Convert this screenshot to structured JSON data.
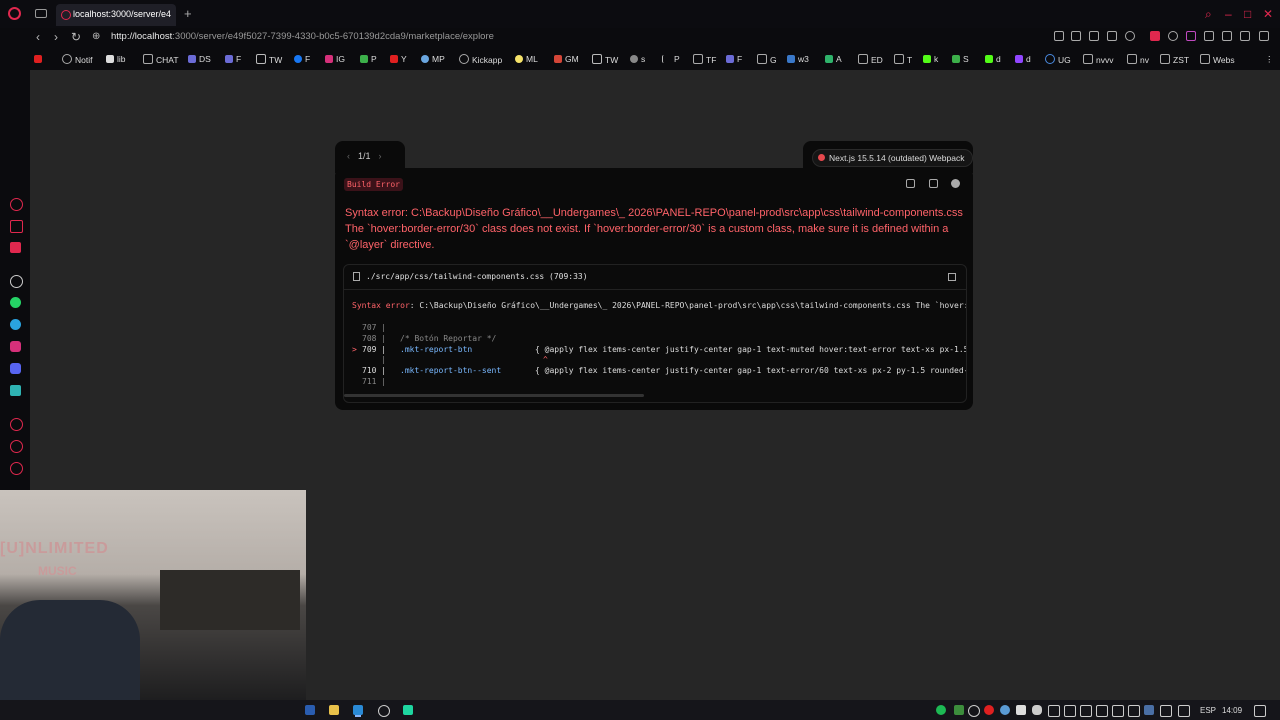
{
  "browser": {
    "tab_title": "localhost:3000/server/e4",
    "new_tab": "+",
    "url_host": "http://localhost",
    "url_path": ":3000/server/e49f5027-7399-4330-b0c5-670139d2cda9/marketplace/explore"
  },
  "bookmarks": [
    "Notif",
    "lib",
    "CHAT",
    "DS",
    "F",
    "TW",
    "F",
    "IG",
    "P",
    "Y",
    "MP",
    "Kickapp",
    "ML",
    "GM",
    "TW",
    "s",
    "P",
    "TF",
    "F",
    "G",
    "w3",
    "A",
    "ED",
    "T",
    "k",
    "S",
    "d",
    "d",
    "UG",
    "nvvv",
    "nv",
    "ZST",
    "Webs"
  ],
  "error_overlay": {
    "pager": "1/1",
    "prev": "‹",
    "next": "›",
    "next_badge": "Next.js 15.5.14 (outdated) Webpack",
    "build_error_label": "Build Error",
    "message": "Syntax error: C:\\Backup\\Diseño Gráfico\\__Undergames\\_ 2026\\PANEL-REPO\\panel-prod\\src\\app\\css\\tailwind-components.css The `hover:border-error/30` class does not exist. If `hover:border-error/30` is a custom class, make sure it is defined within a `@layer` directive.",
    "code_file": "./src/app/css/tailwind-components.css (709:33)",
    "code_error_prefix": "Syntax error",
    "code_error_rest": ": C:\\Backup\\Diseño Gráfico\\__Undergames\\_ 2026\\PANEL-REPO\\panel-prod\\src\\app\\css\\tailwind-components.css The `hover:",
    "lines": [
      {
        "num": "707 |",
        "marker": "",
        "selector": "",
        "content": ""
      },
      {
        "num": "708 |",
        "marker": "",
        "selector": "",
        "content": "/* Botón Reportar */"
      },
      {
        "num": "709 |",
        "marker": ">",
        "selector": ".mkt-report-btn",
        "content": "{ @apply flex items-center justify-center gap-1 text-muted hover:text-error text-xs px-1.5"
      },
      {
        "num": "    |",
        "marker": "",
        "selector": "",
        "content": "^"
      },
      {
        "num": "710 |",
        "marker": "",
        "selector": ".mkt-report-btn--sent",
        "content": "{ @apply flex items-center justify-center gap-1 text-error/60 text-xs px-2 py-1.5 rounded-"
      },
      {
        "num": "711 |",
        "marker": "",
        "selector": "",
        "content": ""
      }
    ]
  },
  "webcam": {
    "sign_line1": "[U]NLIMITED",
    "sign_line2": "MUSIC"
  },
  "taskbar": {
    "lang": "ESP",
    "time": "14:09"
  }
}
